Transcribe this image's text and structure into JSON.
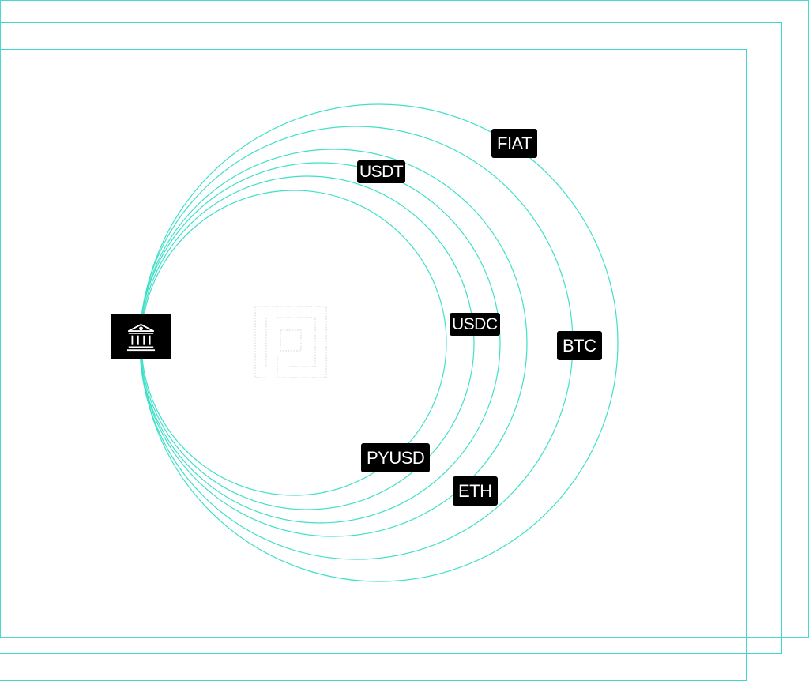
{
  "diagram": {
    "hub_icon": "bank-icon",
    "center_icon": "platform-logo-icon",
    "accent_color": "#3fe0c8",
    "frame_color": "#49d9d2",
    "tag_background": "#000000",
    "tag_text_color": "#ffffff",
    "tags": {
      "fiat": "FIAT",
      "usdt": "USDT",
      "usdc": "USDC",
      "btc": "BTC",
      "pyusd": "PYUSD",
      "eth": "ETH"
    }
  }
}
